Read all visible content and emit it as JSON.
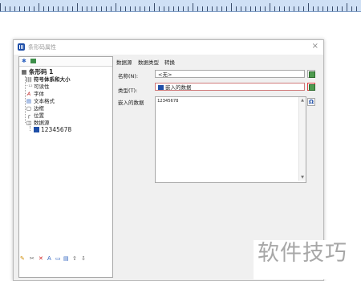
{
  "dialog": {
    "title": "条形码属性",
    "close": "×"
  },
  "tree": {
    "root": "条形码 1",
    "items": [
      {
        "label": "符号体系和大小",
        "icon": "barcode-icon"
      },
      {
        "label": "可读性",
        "icon": "readability-icon"
      },
      {
        "label": "字体",
        "icon": "font-icon"
      },
      {
        "label": "文本格式",
        "icon": "text-format-icon"
      },
      {
        "label": "边框",
        "icon": "border-icon"
      },
      {
        "label": "位置",
        "icon": "position-icon"
      },
      {
        "label": "数据源",
        "icon": "datasource-icon"
      }
    ],
    "leaf": "12345678"
  },
  "tabs": [
    "数据源",
    "数据类型",
    "转换"
  ],
  "form": {
    "name_label": "名称(N):",
    "name_value": "<无>",
    "type_label": "类型(T):",
    "type_value": "嵌入的数据",
    "data_label": "嵌入的数据",
    "data_value": "12345678"
  },
  "buttons": {
    "omega": "Ω"
  },
  "bottom_toolbar": [
    "✎",
    "✂",
    "✕",
    "A",
    "▭",
    "▤",
    "⇧",
    "⇩"
  ],
  "watermark": "软件技巧"
}
